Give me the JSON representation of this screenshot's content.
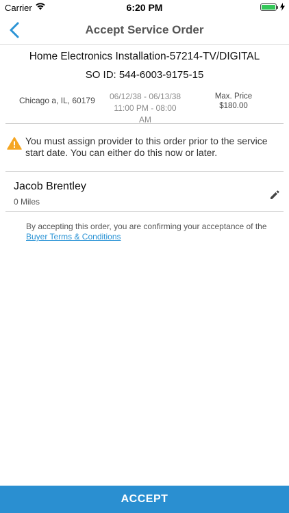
{
  "status_bar": {
    "carrier": "Carrier",
    "time": "6:20 PM",
    "wifi_icon": "wifi-icon",
    "battery_icon": "battery-icon",
    "battery_level": 1.0
  },
  "nav": {
    "back_icon": "chevron-left-icon",
    "title": "Accept Service Order"
  },
  "order": {
    "title": "Home Electronics Installation-57214-TV/DIGITAL",
    "so_id": "SO ID: 544-6003-9175-15",
    "location": "Chicago a, IL, 60179",
    "date_range": "06/12/38 - 06/13/38",
    "time_range": "11:00 PM - 08:00 AM",
    "price_label": "Max. Price",
    "price_value": "$180.00"
  },
  "warning": {
    "icon": "warning-triangle-icon",
    "text": "You must assign provider to this order prior to the service start date. You can either do this now or later."
  },
  "provider": {
    "name": "Jacob Brentley",
    "distance": "0 Miles",
    "edit_icon": "pencil-icon"
  },
  "terms": {
    "text": "By accepting this order, you are confirming your acceptance of the ",
    "link": "Buyer Terms & Conditions"
  },
  "footer": {
    "accept_label": "ACCEPT"
  },
  "colors": {
    "accent": "#2a8fd1",
    "warning": "#f5a623",
    "battery": "#34c759"
  }
}
